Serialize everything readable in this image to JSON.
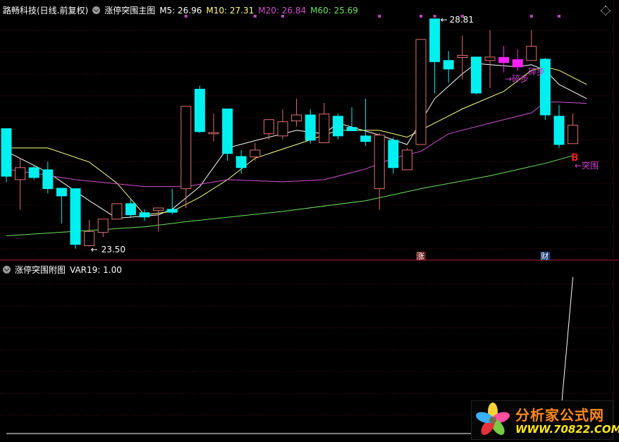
{
  "header": {
    "stock_title": "路畅科技(日线.前复权)",
    "main_indicator": "涨停突围主图",
    "ma5": "M5: 26.96",
    "ma10": "M10: 27.31",
    "ma20": "M20: 26.84",
    "ma60": "M60: 25.69"
  },
  "sub_panel": {
    "indicator": "涨停突围附图",
    "value": "VAR19: 1.00"
  },
  "annotations": {
    "high_label": "28.81",
    "low_label": "23.50",
    "step1": "→碎步",
    "step2": "碎步",
    "buy": "B",
    "breakout": "←突围",
    "marker_zhang": "涨",
    "marker_cai": "财"
  },
  "logo": {
    "name": "分析家公式网",
    "url": "WWW.70822.COM"
  },
  "colors": {
    "up": "#e07070",
    "down": "#00f0f0",
    "special": "#ff20ff",
    "ma5": "#ffffff",
    "ma10": "#ffff80",
    "ma20": "#d050d0",
    "ma60": "#70e060",
    "grid": "#5a1010"
  },
  "chart_data": {
    "type": "candlestick",
    "title": "路畅科技(日线.前复权)",
    "ylim": [
      23.2,
      29.25
    ],
    "high_marker_index": 31,
    "low_marker_index": 6,
    "special_indices": [
      36,
      37
    ],
    "signal_dot_indices": [
      13,
      18,
      20,
      27,
      30,
      31,
      33,
      38,
      40
    ],
    "zhang_index": 30,
    "cai_index": 39,
    "ohlc": [
      [
        26.25,
        26.25,
        25.0,
        25.14
      ],
      [
        25.06,
        25.56,
        24.36,
        25.34
      ],
      [
        25.34,
        25.4,
        25.06,
        25.11
      ],
      [
        25.29,
        25.48,
        24.74,
        24.85
      ],
      [
        24.86,
        24.86,
        24.04,
        24.68
      ],
      [
        24.85,
        24.85,
        23.45,
        23.55
      ],
      [
        23.52,
        24.12,
        23.5,
        23.85
      ],
      [
        23.83,
        24.14,
        23.72,
        24.14
      ],
      [
        24.14,
        24.5,
        24.14,
        24.5
      ],
      [
        24.5,
        24.6,
        24.17,
        24.24
      ],
      [
        24.29,
        24.37,
        24.1,
        24.19
      ],
      [
        24.34,
        24.4,
        23.85,
        24.4
      ],
      [
        24.37,
        24.85,
        24.25,
        24.3
      ],
      [
        24.85,
        26.77,
        24.4,
        26.77
      ],
      [
        27.17,
        27.25,
        26.15,
        26.18
      ],
      [
        26.13,
        26.6,
        25.95,
        26.16
      ],
      [
        26.71,
        26.71,
        25.5,
        25.67
      ],
      [
        25.6,
        25.75,
        25.2,
        25.34
      ],
      [
        25.59,
        25.92,
        25.5,
        25.75
      ],
      [
        26.13,
        26.46,
        26.0,
        26.46
      ],
      [
        26.08,
        26.7,
        26.0,
        26.41
      ],
      [
        26.43,
        26.95,
        26.3,
        26.57
      ],
      [
        26.57,
        26.7,
        25.9,
        25.98
      ],
      [
        25.92,
        26.85,
        25.92,
        26.59
      ],
      [
        26.54,
        26.6,
        26.0,
        26.08
      ],
      [
        26.28,
        26.75,
        26.2,
        26.2
      ],
      [
        26.08,
        26.95,
        25.85,
        25.95
      ],
      [
        24.85,
        26.15,
        24.36,
        26.1
      ],
      [
        25.98,
        26.05,
        25.2,
        25.34
      ],
      [
        25.29,
        25.8,
        25.29,
        25.75
      ],
      [
        25.88,
        28.33,
        25.88,
        28.33
      ],
      [
        28.81,
        28.81,
        27.07,
        27.81
      ],
      [
        27.84,
        28.06,
        27.32,
        27.64
      ],
      [
        27.91,
        28.42,
        27.4,
        27.96
      ],
      [
        27.92,
        27.92,
        27.05,
        27.08
      ],
      [
        27.84,
        28.55,
        27.2,
        27.92
      ],
      [
        27.91,
        28.18,
        27.56,
        27.79
      ],
      [
        27.86,
        28.1,
        27.6,
        27.69
      ],
      [
        27.84,
        28.55,
        27.84,
        28.17
      ],
      [
        27.87,
        27.9,
        26.45,
        26.57
      ],
      [
        26.54,
        26.8,
        25.8,
        25.88
      ],
      [
        25.9,
        26.6,
        25.9,
        26.33
      ]
    ],
    "ma_series": {
      "M5": [
        [
          0,
          25.72
        ],
        [
          3,
          25.23
        ],
        [
          6,
          24.57
        ],
        [
          8,
          24.16
        ],
        [
          11,
          24.24
        ],
        [
          12,
          24.37
        ],
        [
          14,
          24.9
        ],
        [
          16,
          25.8
        ],
        [
          18,
          25.97
        ],
        [
          21,
          26.21
        ],
        [
          23,
          26.13
        ],
        [
          24,
          26.38
        ],
        [
          27,
          26.1
        ],
        [
          29,
          25.88
        ],
        [
          31,
          26.95
        ],
        [
          33,
          27.53
        ],
        [
          34,
          27.77
        ],
        [
          35,
          27.74
        ],
        [
          37,
          27.69
        ],
        [
          38,
          27.74
        ],
        [
          39,
          27.61
        ],
        [
          40,
          27.28
        ],
        [
          42,
          26.95
        ]
      ],
      "M10": [
        [
          0,
          25.8
        ],
        [
          3,
          25.8
        ],
        [
          6,
          25.47
        ],
        [
          8,
          24.98
        ],
        [
          10,
          24.24
        ],
        [
          12,
          24.32
        ],
        [
          14,
          24.65
        ],
        [
          16,
          25.06
        ],
        [
          18,
          25.56
        ],
        [
          21,
          25.88
        ],
        [
          24,
          26.21
        ],
        [
          27,
          26.21
        ],
        [
          29,
          26.05
        ],
        [
          31,
          26.38
        ],
        [
          33,
          26.71
        ],
        [
          36,
          27.12
        ],
        [
          38,
          27.61
        ],
        [
          39,
          27.69
        ],
        [
          40,
          27.61
        ],
        [
          42,
          27.28
        ]
      ],
      "M20": [
        [
          0,
          25.31
        ],
        [
          5,
          25.06
        ],
        [
          10,
          24.9
        ],
        [
          13,
          24.9
        ],
        [
          16,
          25.06
        ],
        [
          20,
          25.01
        ],
        [
          23,
          25.06
        ],
        [
          26,
          25.31
        ],
        [
          28,
          25.56
        ],
        [
          30,
          25.72
        ],
        [
          32,
          26.13
        ],
        [
          35,
          26.38
        ],
        [
          38,
          26.62
        ],
        [
          39,
          26.87
        ],
        [
          40,
          26.87
        ],
        [
          42,
          26.84
        ]
      ],
      "M60": [
        [
          0,
          23.75
        ],
        [
          10,
          23.96
        ],
        [
          13,
          24.08
        ],
        [
          20,
          24.32
        ],
        [
          26,
          24.57
        ],
        [
          30,
          24.85
        ],
        [
          35,
          25.15
        ],
        [
          39,
          25.44
        ],
        [
          41,
          25.62
        ]
      ]
    },
    "var19": {
      "ylim": [
        0,
        1
      ],
      "values": [
        0,
        0,
        0,
        0,
        0,
        0,
        0,
        0,
        0,
        0,
        0,
        0,
        0,
        0,
        0,
        0,
        0,
        0,
        0,
        0,
        0,
        0,
        0,
        0,
        0,
        0,
        0,
        0,
        0,
        0,
        0,
        0,
        0,
        0,
        0,
        0,
        0,
        0,
        0,
        0,
        0,
        1
      ]
    }
  }
}
